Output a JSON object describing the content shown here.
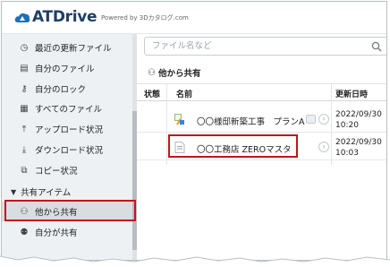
{
  "header": {
    "app_name": "ATDrive",
    "powered_by": "Powered by 3Dカタログ.com"
  },
  "sidebar": {
    "items": [
      {
        "label": "最近の更新ファイル",
        "icon": "recent-clock-icon"
      },
      {
        "label": "自分のファイル",
        "icon": "my-files-icon"
      },
      {
        "label": "自分のロック",
        "icon": "key-icon"
      },
      {
        "label": "すべてのファイル",
        "icon": "all-files-icon"
      },
      {
        "label": "アップロード状況",
        "icon": "upload-icon"
      },
      {
        "label": "ダウンロード状況",
        "icon": "download-icon"
      },
      {
        "label": "コピー状況",
        "icon": "copy-icon"
      }
    ],
    "section": {
      "label": "共有アイテム",
      "caret": "▼"
    },
    "shared_items": [
      {
        "label": "他から共有",
        "icon": "shared-from-others-icon",
        "active": true
      },
      {
        "label": "自分が共有",
        "icon": "shared-by-me-icon"
      }
    ]
  },
  "main": {
    "search_placeholder": "ファイル名など",
    "folder_title": "他から共有",
    "columns": {
      "status": "状態",
      "name": "名前",
      "updated": "更新日時"
    },
    "rows": [
      {
        "name": "〇〇様邸新築工事　プランA",
        "date": "2022/09/30",
        "time": "10:20",
        "file_type": "plan-file-icon",
        "has_thumbnail": true
      },
      {
        "name": "〇〇工務店 ZEROマスタ",
        "date": "2022/09/30",
        "time": "10:03",
        "file_type": "master-file-icon",
        "has_thumbnail": false
      }
    ]
  },
  "colors": {
    "highlight": "#c0161c",
    "brand": "#1f3f63",
    "sidebar_bg": "#eef1f3"
  }
}
